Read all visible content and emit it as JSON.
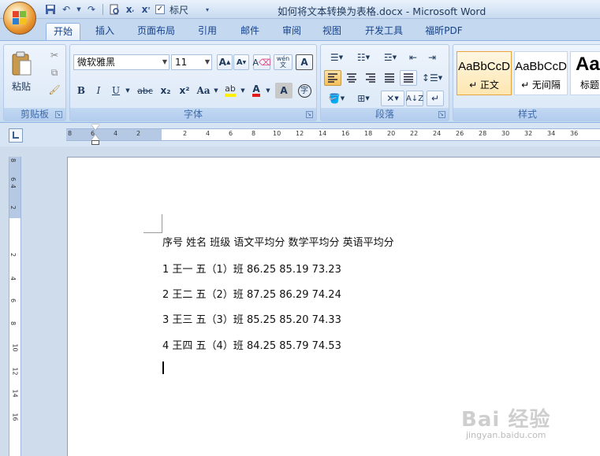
{
  "window": {
    "title": "如何将文本转换为表格.docx - Microsoft Word"
  },
  "quick_access": {
    "ruler_label": "标尺",
    "ruler_checked": "✓"
  },
  "tabs": [
    "开始",
    "插入",
    "页面布局",
    "引用",
    "邮件",
    "审阅",
    "视图",
    "开发工具",
    "福昕PDF"
  ],
  "ribbon": {
    "clipboard": {
      "paste_label": "粘贴",
      "group_label": "剪贴板"
    },
    "font": {
      "font_name": "微软雅黑",
      "font_size": "11",
      "group_label": "字体",
      "bold": "B",
      "italic": "I",
      "underline": "U",
      "strike": "abc",
      "subscript": "x₂",
      "superscript": "x²",
      "change_case": "Aa",
      "grow": "A",
      "shrink": "A",
      "clear": "A",
      "phonetic": "wén 文",
      "border_char": "A",
      "shading_char": "A",
      "enclose_char": "字"
    },
    "paragraph": {
      "group_label": "段落"
    },
    "styles": {
      "group_label": "样式",
      "items": [
        {
          "sample": "AaBbCcD",
          "name": "↵ 正文"
        },
        {
          "sample": "AaBbCcD",
          "name": "↵ 无间隔"
        },
        {
          "sample": "Aa",
          "name": "标题"
        }
      ]
    }
  },
  "ruler": {
    "h_ticks": [
      "8",
      "6",
      "4",
      "2",
      "2",
      "4",
      "6",
      "8",
      "10",
      "12",
      "14",
      "16",
      "18",
      "20",
      "22",
      "24",
      "26",
      "28",
      "30",
      "32",
      "34",
      "36"
    ],
    "v_ticks": [
      "8",
      "6",
      "4",
      "2",
      "2",
      "4",
      "6",
      "8",
      "10",
      "12",
      "14",
      "16"
    ]
  },
  "document": {
    "lines": [
      "序号 姓名 班级 语文平均分 数学平均分 英语平均分",
      "1 王一 五（1）班 86.25 85.19 73.23",
      "2 王二 五（2）班 87.25 86.29 74.24",
      "3 王三 五（3）班 85.25 85.20 74.33",
      "4 王四 五（4）班 84.25 85.79 74.53"
    ]
  },
  "watermark": {
    "main": "Bai 经验",
    "sub": "jingyan.baidu.com"
  }
}
